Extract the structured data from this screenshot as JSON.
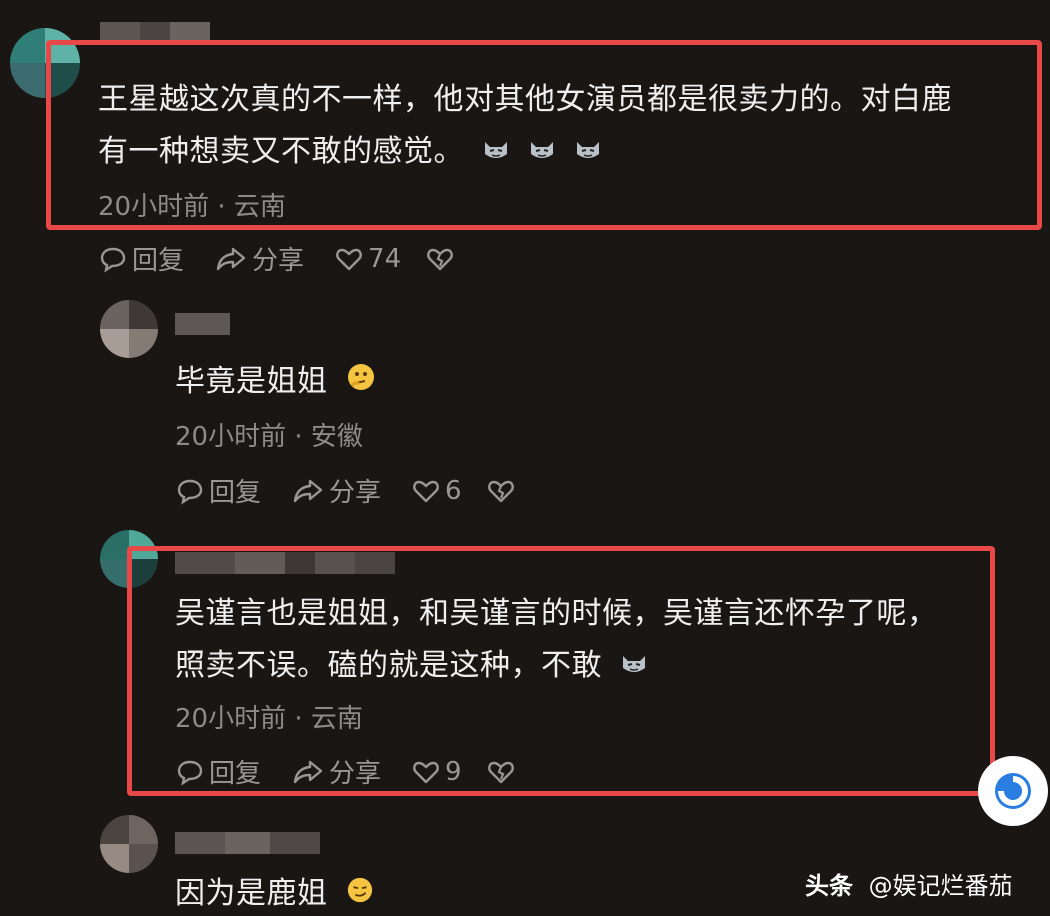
{
  "comments": [
    {
      "text_line1": "王星越这次真的不一样，他对其他女演员都是很卖力的。对白鹿",
      "text_line2": "有一种想卖又不敢的感觉。",
      "meta": "20小时前 · 云南",
      "reply_label": "回复",
      "share_label": "分享",
      "likes": "74"
    },
    {
      "text_line1": "毕竟是姐姐",
      "meta": "20小时前 · 安徽",
      "reply_label": "回复",
      "share_label": "分享",
      "likes": "6"
    },
    {
      "text_line1": "吴谨言也是姐姐，和吴谨言的时候，吴谨言还怀孕了呢，",
      "text_line2": "照卖不误。磕的就是这种，不敢",
      "meta": "20小时前 · 云南",
      "reply_label": "回复",
      "share_label": "分享",
      "likes": "9"
    },
    {
      "text_line1": "因为是鹿姐"
    }
  ],
  "watermark": {
    "brand": "头条",
    "account": "@娱记烂番茄"
  },
  "colors": {
    "highlight": "#e84848",
    "background": "#1a1614",
    "meta": "#8e8a87"
  },
  "icons": [
    "comment-bubble-icon",
    "share-arrow-icon",
    "heart-icon",
    "broken-heart-icon",
    "smirk-cat-emoji",
    "thinking-emoji"
  ]
}
